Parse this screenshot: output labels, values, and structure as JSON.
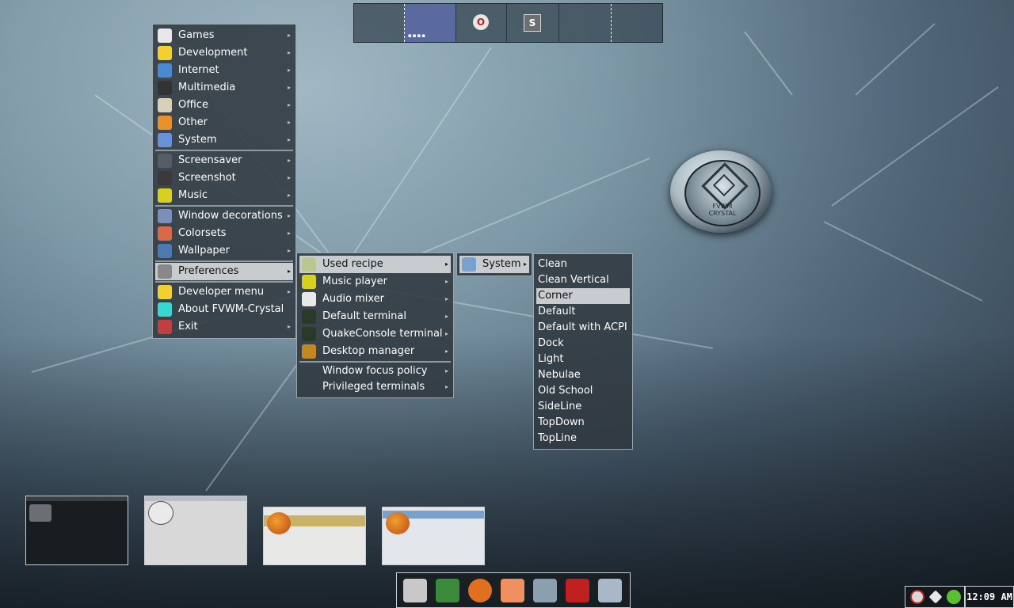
{
  "pager": {
    "desks": [
      "",
      "",
      "",
      ""
    ],
    "active_index": 1,
    "mini_label": "▪▪▪▪",
    "icon2": "O",
    "icon3": "S"
  },
  "emblem": {
    "brand": "FVWM CRYSTAL"
  },
  "main_menu": {
    "items": [
      {
        "label": "Games",
        "icon": "cards-icon",
        "color": "#e8e8e8",
        "arrow": "▸"
      },
      {
        "label": "Development",
        "icon": "gnu-icon",
        "color": "#f2d030",
        "arrow": "▸"
      },
      {
        "label": "Internet",
        "icon": "globe-icon",
        "color": "#4a8ad0",
        "arrow": "▸"
      },
      {
        "label": "Multimedia",
        "icon": "clapper-icon",
        "color": "#333333",
        "arrow": "▸"
      },
      {
        "label": "Office",
        "icon": "office-icon",
        "color": "#d8d0b8",
        "arrow": "▸"
      },
      {
        "label": "Other",
        "icon": "diamond-icon",
        "color": "#e8902a",
        "arrow": "▸"
      },
      {
        "label": "System",
        "icon": "gear-icon",
        "color": "#6a90d8",
        "arrow": "▸"
      },
      {
        "label": "Screensaver",
        "icon": "monitor-icon",
        "color": "#555e66",
        "arrow": "▸"
      },
      {
        "label": "Screenshot",
        "icon": "camera-icon",
        "color": "#3a3a3a",
        "arrow": "▸"
      },
      {
        "label": "Music",
        "icon": "music-note-icon",
        "color": "#d8d020",
        "arrow": "▸"
      },
      {
        "label": "Window decorations",
        "icon": "window-deco-icon",
        "color": "#7a90b8",
        "arrow": "▸"
      },
      {
        "label": "Colorsets",
        "icon": "palette-icon",
        "color": "#d86a4a",
        "arrow": "▸"
      },
      {
        "label": "Wallpaper",
        "icon": "wallpaper-icon",
        "color": "#4a7ab0",
        "arrow": "▸"
      },
      {
        "label": "Preferences",
        "icon": "preferences-icon",
        "color": "#888888",
        "arrow": "▸"
      },
      {
        "label": "Developer menu",
        "icon": "gnu-icon",
        "color": "#f2d030",
        "arrow": "▸"
      },
      {
        "label": "About FVWM-Crystal",
        "icon": "crystal-icon",
        "color": "#38d8d0",
        "arrow": ""
      },
      {
        "label": "Exit",
        "icon": "exit-icon",
        "color": "#c04040",
        "arrow": "▸"
      }
    ]
  },
  "prefs_menu": {
    "items": [
      {
        "label": "Used recipe",
        "icon": "recipe-icon",
        "color": "#b8c890",
        "arrow": "▸"
      },
      {
        "label": "Music player",
        "icon": "music-note-icon",
        "color": "#d8d020",
        "arrow": "▸"
      },
      {
        "label": "Audio mixer",
        "icon": "mixer-icon",
        "color": "#e8e8e8",
        "arrow": "▸"
      },
      {
        "label": "Default terminal",
        "icon": "terminal-icon",
        "color": "#2a3a2a",
        "arrow": "▸"
      },
      {
        "label": "QuakeConsole terminal",
        "icon": "terminal-icon",
        "color": "#2a3a2a",
        "arrow": "▸"
      },
      {
        "label": "Desktop manager",
        "icon": "desktop-manager-icon",
        "color": "#c08a20",
        "arrow": "▸"
      },
      {
        "label": "Window focus policy",
        "icon": "",
        "color": "",
        "arrow": "▸"
      },
      {
        "label": "Privileged terminals",
        "icon": "",
        "color": "",
        "arrow": "▸"
      }
    ]
  },
  "recipe_menu": {
    "items": [
      {
        "label": "System",
        "icon": "folder-icon",
        "arrow": "▸"
      }
    ]
  },
  "system_recipes": {
    "items": [
      "Clean",
      "Clean Vertical",
      "Corner",
      "Default",
      "Default with ACPI",
      "Dock",
      "Light",
      "Nebulae",
      "Old School",
      "SideLine",
      "TopDown",
      "TopLine"
    ],
    "selected": "Corner"
  },
  "launcher": {
    "icons": [
      "solitaire-icon",
      "vim-icon",
      "firefox-icon",
      "sawfish-icon",
      "document-icon",
      "logo-iib-icon",
      "image-viewer-icon"
    ]
  },
  "tray": {
    "icons": [
      "network-icon",
      "rocket-icon",
      "leaf-icon"
    ]
  },
  "clock": {
    "time": "12:09 AM"
  }
}
